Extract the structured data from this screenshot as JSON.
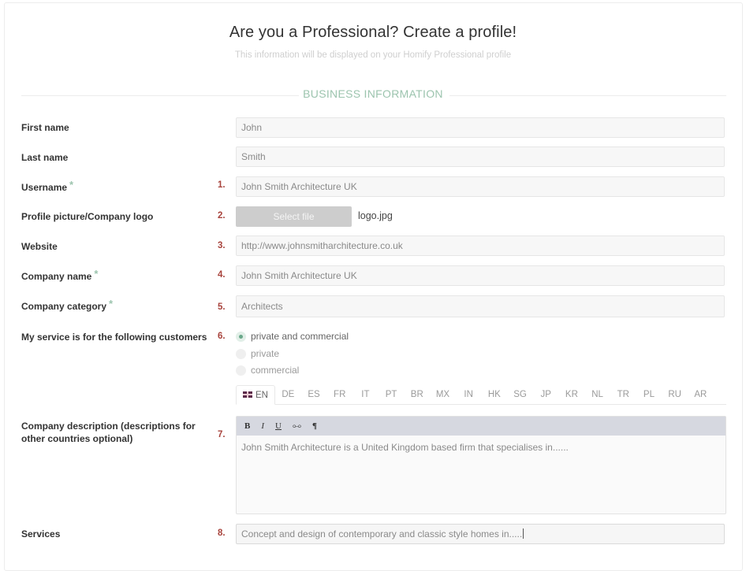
{
  "header": {
    "title": "Are you a Professional? Create a profile!",
    "subtitle": "This information will be displayed on your Homify Professional profile",
    "section_title": "BUSINESS INFORMATION"
  },
  "colors": {
    "accent_green": "#9cc4ae",
    "step_number_red": "#a8433c",
    "toolbar_bg": "#d6d8e0"
  },
  "form": {
    "first_name": {
      "label": "First name",
      "value": "John"
    },
    "last_name": {
      "label": "Last name",
      "value": "Smith"
    },
    "username": {
      "label": "Username",
      "required": "*",
      "step": "1.",
      "value": "John Smith Architecture UK"
    },
    "logo": {
      "label": "Profile picture/Company logo",
      "step": "2.",
      "button_label": "Select file",
      "file_name": "logo.jpg"
    },
    "website": {
      "label": "Website",
      "step": "3.",
      "value": "http://www.johnsmitharchitecture.co.uk"
    },
    "company_name": {
      "label": "Company name",
      "required": "*",
      "step": "4.",
      "value": "John Smith Architecture UK"
    },
    "company_category": {
      "label": "Company category",
      "required": "*",
      "step": "5.",
      "value": "Architects"
    },
    "customers": {
      "label": "My service is for the following customers",
      "step": "6.",
      "options": [
        {
          "label": "private and commercial",
          "checked": true
        },
        {
          "label": "private",
          "checked": false
        },
        {
          "label": "commercial",
          "checked": false
        }
      ]
    },
    "description": {
      "label": "Company description (descriptions for other countries optional)",
      "step": "7.",
      "language_tabs": [
        "EN",
        "DE",
        "ES",
        "FR",
        "IT",
        "PT",
        "BR",
        "MX",
        "IN",
        "HK",
        "SG",
        "JP",
        "KR",
        "NL",
        "TR",
        "PL",
        "RU",
        "AR"
      ],
      "active_tab": "EN",
      "toolbar": {
        "bold": "B",
        "italic": "I",
        "underline": "U",
        "link": "⧟",
        "paragraph": "¶"
      },
      "value": "John Smith Architecture is a United Kingdom based firm that specialises in......"
    },
    "services": {
      "label": "Services",
      "step": "8.",
      "value": "Concept and design of contemporary and classic style homes in....."
    }
  }
}
